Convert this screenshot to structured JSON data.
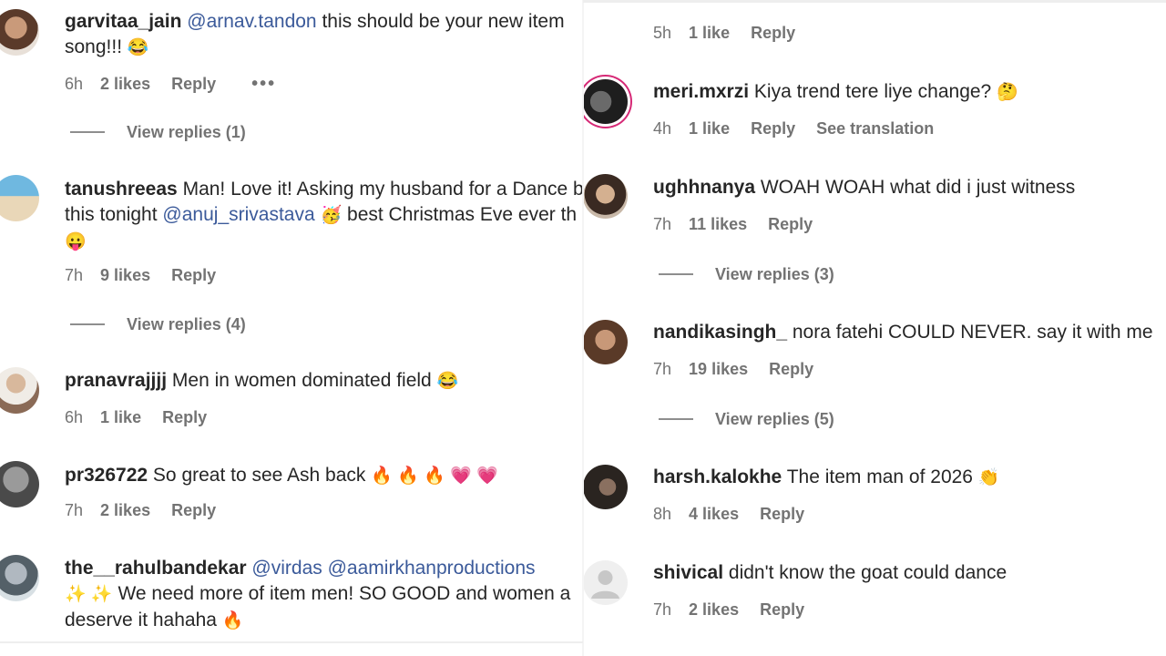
{
  "left": {
    "comments": [
      {
        "user": "garvitaa_jain",
        "mention": "@arnav.tandon",
        "text1": "this should be your new item",
        "text2": "song!!!",
        "emoji": "😂",
        "time": "6h",
        "likes": "2 likes",
        "reply": "Reply",
        "more": "•••",
        "view_replies": "View replies (1)"
      },
      {
        "user": "tanushreeas",
        "text1": "Man! Love it! Asking my husband for a Dance b",
        "mention": "@anuj_srivastava",
        "text2": "this tonight",
        "emoji": "🥳",
        "text3": "best Christmas Eve ever th",
        "emoji2": "😛",
        "time": "7h",
        "likes": "9 likes",
        "reply": "Reply",
        "view_replies": "View replies (4)"
      },
      {
        "user": "pranavrajjjj",
        "text1": "Men in women dominated field",
        "emoji": "😂",
        "time": "6h",
        "likes": "1 like",
        "reply": "Reply"
      },
      {
        "user": "pr326722",
        "text1": "So great to see Ash back",
        "emoji": "🔥 🔥 🔥 💗 💗",
        "time": "7h",
        "likes": "2 likes",
        "reply": "Reply"
      },
      {
        "user": "the__rahulbandekar",
        "mention": "@virdas",
        "mention2": "@aamirkhanproductions",
        "emoji": "✨ ✨",
        "text2": "We need more of item men! SO GOOD and women a",
        "text3": "deserve it hahaha",
        "emoji2": "🔥"
      }
    ]
  },
  "right": {
    "partial": {
      "time": "5h",
      "likes": "1 like",
      "reply": "Reply"
    },
    "comments": [
      {
        "user": "meri.mxrzi",
        "text1": "Kiya trend tere liye change?",
        "emoji": "🤔",
        "time": "4h",
        "likes": "1 like",
        "reply": "Reply",
        "translate": "See translation"
      },
      {
        "user": "ughhnanya",
        "text1": "WOAH WOAH what did i just witness",
        "time": "7h",
        "likes": "11 likes",
        "reply": "Reply",
        "view_replies": "View replies (3)"
      },
      {
        "user": "nandikasingh_",
        "text1": "nora fatehi COULD NEVER. say it with me",
        "time": "7h",
        "likes": "19 likes",
        "reply": "Reply",
        "view_replies": "View replies (5)"
      },
      {
        "user": "harsh.kalokhe",
        "text1": "The item man of 2026",
        "emoji": "👏",
        "time": "8h",
        "likes": "4 likes",
        "reply": "Reply"
      },
      {
        "user": "shivical",
        "text1": "didn't know the goat could dance",
        "time": "7h",
        "likes": "2 likes",
        "reply": "Reply"
      }
    ]
  },
  "colors": {
    "text": "#262626",
    "meta": "#737373",
    "mention": "#3b5a9a",
    "story_ring": "#d62976"
  },
  "icons": [
    "user-avatar",
    "default-avatar-icon",
    "more-options-icon"
  ]
}
